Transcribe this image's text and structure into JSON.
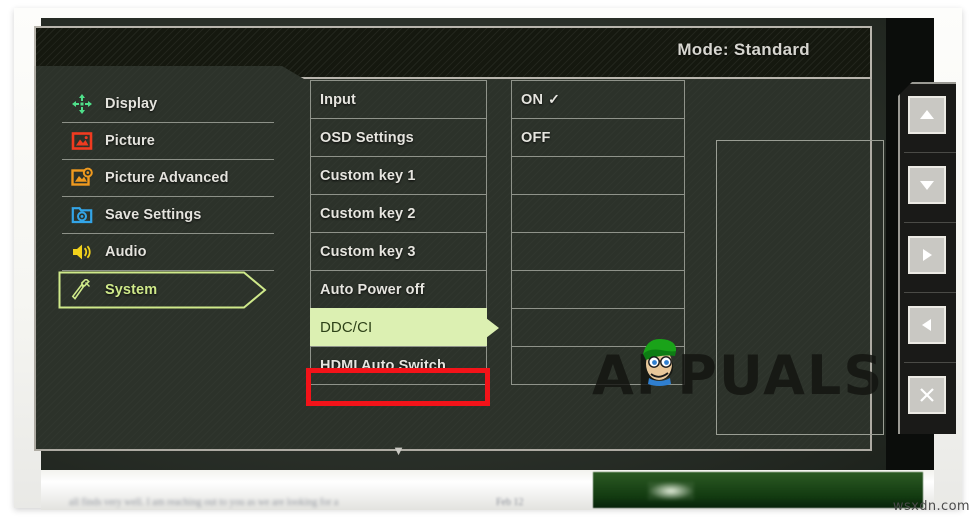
{
  "osd": {
    "title": "Mode: Standard",
    "sidebar": {
      "items": [
        {
          "label": "Display",
          "icon": "display-arrows-icon",
          "color": "#4fe08a",
          "selected": false
        },
        {
          "label": "Picture",
          "icon": "picture-frame-icon",
          "color": "#f03b20",
          "selected": false
        },
        {
          "label": "Picture Advanced",
          "icon": "picture-advanced-icon",
          "color": "#f09a1e",
          "selected": false
        },
        {
          "label": "Save Settings",
          "icon": "save-folder-icon",
          "color": "#33a5e8",
          "selected": false
        },
        {
          "label": "Audio",
          "icon": "speaker-icon",
          "color": "#f2d21c",
          "selected": false
        },
        {
          "label": "System",
          "icon": "wrench-icon",
          "color": "#cfe98a",
          "selected": true
        }
      ]
    },
    "menu": {
      "items": [
        {
          "label": "Input",
          "highlighted": false
        },
        {
          "label": "OSD Settings",
          "highlighted": false
        },
        {
          "label": "Custom key 1",
          "highlighted": false
        },
        {
          "label": "Custom key 2",
          "highlighted": false
        },
        {
          "label": "Custom key 3",
          "highlighted": false
        },
        {
          "label": "Auto Power off",
          "highlighted": false
        },
        {
          "label": "DDC/CI",
          "highlighted": true
        },
        {
          "label": "HDMI Auto Switch",
          "highlighted": false
        }
      ],
      "scroll_down_icon": "chevron-down-icon"
    },
    "values": {
      "options": [
        {
          "label": "ON",
          "selected": true,
          "check": "✓"
        },
        {
          "label": "OFF",
          "selected": false,
          "check": ""
        }
      ]
    },
    "annotation": {
      "highlight_box_color": "#f31319",
      "target": "DDC/CI"
    }
  },
  "hardware_buttons": [
    {
      "name": "up-arrow-button",
      "glyph": "▲"
    },
    {
      "name": "down-arrow-button",
      "glyph": "▼"
    },
    {
      "name": "right-arrow-button",
      "glyph": "▶"
    },
    {
      "name": "left-arrow-button",
      "glyph": "◀"
    },
    {
      "name": "close-button",
      "glyph": "✕"
    }
  ],
  "watermarks": {
    "brand": "APPUALS",
    "site": "wsxdn.com"
  },
  "desktop": {
    "blurred_text": "all finds very well. I am reaching out to you as we are looking for a",
    "date": "Feb 12"
  }
}
